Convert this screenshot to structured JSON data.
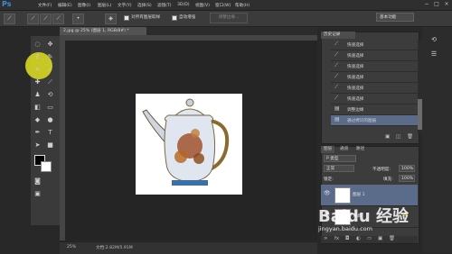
{
  "app": {
    "logo": "Ps"
  },
  "menu": [
    "文件(F)",
    "编辑(E)",
    "图像(I)",
    "图层(L)",
    "文字(Y)",
    "选择(S)",
    "滤镜(T)",
    "3D(D)",
    "视图(V)",
    "窗口(W)",
    "帮助(H)"
  ],
  "window_controls": {
    "minimize": "−",
    "maximize": "□",
    "close": "×"
  },
  "options": {
    "sample_all_layers": "对所有图层取样",
    "auto_enhance": "自动增强",
    "refine_edge": "调整边缘...",
    "workspace": "基本功能"
  },
  "document": {
    "tab_title": "2.jpg @ 25% (图层 1, RGB/8#) *",
    "zoom": "25%",
    "doc_size": "文档:2.82M/5.91M"
  },
  "history": {
    "tab_title": "历史记录",
    "items": [
      "快速选择",
      "快速选择",
      "快速选择",
      "快速选择",
      "快速选择",
      "快速选择",
      "调整边缘",
      "通过拷贝的图层"
    ]
  },
  "layers": {
    "tabs": [
      "图层",
      "通道",
      "路径"
    ],
    "filter_label": "P 类型",
    "blend_mode": "正常",
    "opacity_label": "不透明度:",
    "opacity_value": "100%",
    "lock_label": "锁定:",
    "fill_label": "填充:",
    "fill_value": "100%",
    "items": [
      {
        "name": "图层 1",
        "selected": true
      },
      {
        "name": "背景",
        "selected": false
      }
    ]
  },
  "watermark": {
    "logo": "Baidu 经验",
    "url": "jingyan.baidu.com"
  },
  "colors": {
    "accent": "#3d8fd9",
    "highlight": "#e1e123",
    "selected_layer": "#5a6c8a"
  }
}
